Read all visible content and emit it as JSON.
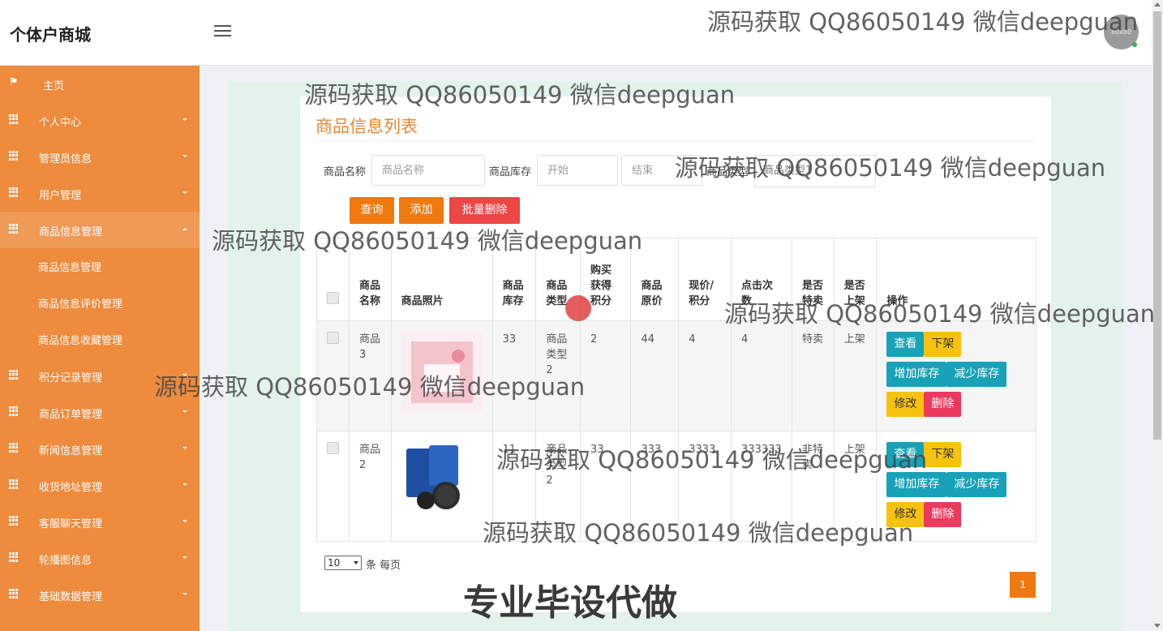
{
  "header": {
    "app_title": "个体户商城",
    "avatar_text": "80x80"
  },
  "sidebar": {
    "items": [
      {
        "label": "主页",
        "icon": "flag-icon"
      },
      {
        "label": "个人中心",
        "icon": "grid-icon"
      },
      {
        "label": "管理员信息",
        "icon": "grid-icon"
      },
      {
        "label": "用户管理",
        "icon": "grid-icon"
      },
      {
        "label": "商品信息管理",
        "icon": "grid-icon",
        "expanded": true
      },
      {
        "label": "积分记录管理",
        "icon": "grid-icon"
      },
      {
        "label": "商品订单管理",
        "icon": "grid-icon"
      },
      {
        "label": "新闻信息管理",
        "icon": "grid-icon"
      },
      {
        "label": "收货地址管理",
        "icon": "grid-icon"
      },
      {
        "label": "客服聊天管理",
        "icon": "grid-icon"
      },
      {
        "label": "轮播图信息",
        "icon": "grid-icon"
      },
      {
        "label": "基础数据管理",
        "icon": "grid-icon"
      }
    ],
    "subitems": [
      {
        "label": "商品信息管理"
      },
      {
        "label": "商品信息评价管理"
      },
      {
        "label": "商品信息收藏管理"
      }
    ]
  },
  "page": {
    "title": "商品信息列表"
  },
  "filters": {
    "name_label": "商品名称",
    "name_placeholder": "商品名称",
    "stock_label": "商品库存",
    "stock_start_placeholder": "开始",
    "stock_end_placeholder": "结束",
    "type_label": "商品类型",
    "type_select_value": "商品类型1"
  },
  "buttons": {
    "search": "查询",
    "add": "添加",
    "batch_delete": "批量删除"
  },
  "table": {
    "headers": [
      "商品名称",
      "商品照片",
      "商品库存",
      "商品类型",
      "购买获得积分",
      "商品原价",
      "现价/积分",
      "点击次数",
      "是否特卖",
      "是否上架",
      "操作"
    ],
    "rows": [
      {
        "name": "商品3",
        "stock": "33",
        "type": "商品类型2",
        "points": "2",
        "original_price": "44",
        "current_price": "4",
        "clicks": "4",
        "special": "特卖",
        "on_shelf": "上架"
      },
      {
        "name": "商品2",
        "stock": "11",
        "type": "商品类型2",
        "points": "33",
        "original_price": "333",
        "current_price": "3333",
        "clicks": "333333",
        "special": "非特卖",
        "on_shelf": "上架"
      }
    ],
    "actions": {
      "view": "查看",
      "off_shelf": "下架",
      "add_stock": "增加库存",
      "reduce_stock": "减少库存",
      "edit": "修改",
      "delete": "删除"
    }
  },
  "pagination": {
    "page_size": "10",
    "page_size_label": "条 每页",
    "current_page": "1"
  },
  "watermarks": {
    "text": "源码获取 QQ86050149 微信deepguan",
    "big": "专业毕设代做"
  },
  "colors": {
    "sidebar": "#ee8b3d",
    "accent": "#f0790e",
    "danger": "#ee4545",
    "teal": "#17a2b8",
    "yellow": "#f6c20e",
    "pink": "#eb3a5e"
  }
}
